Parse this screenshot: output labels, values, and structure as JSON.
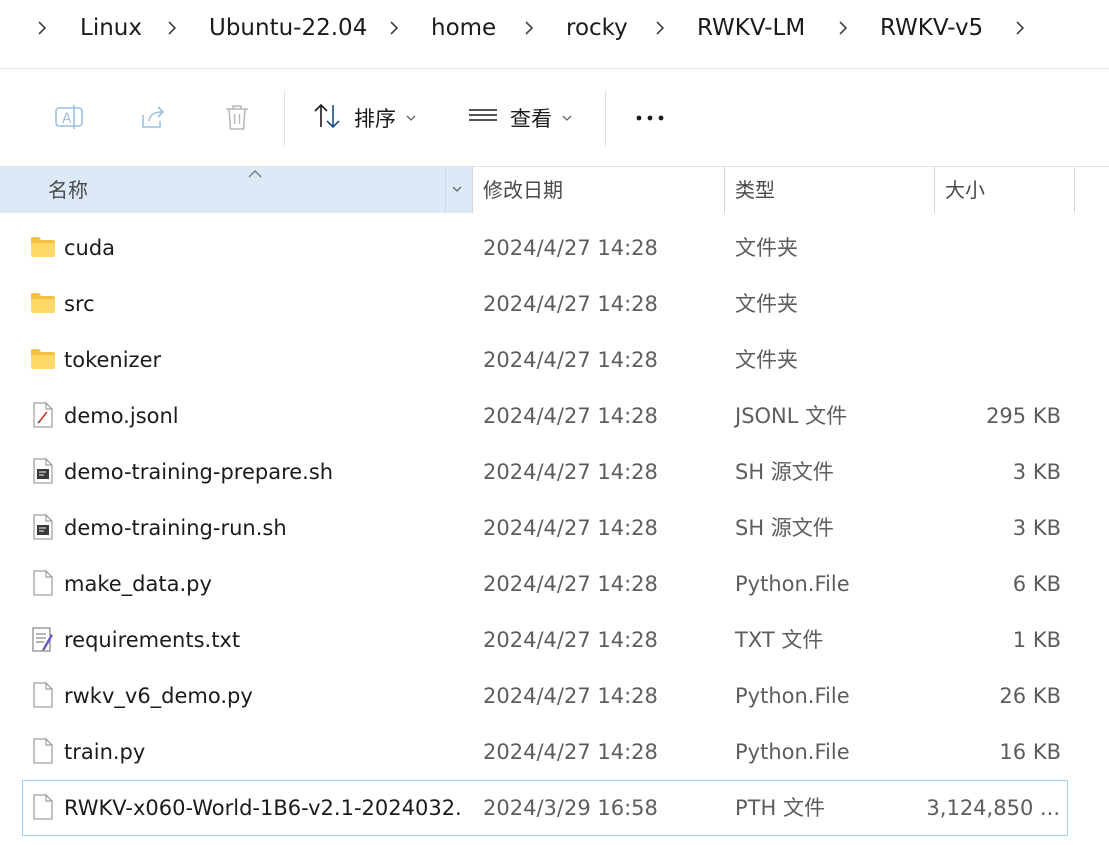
{
  "breadcrumb": [
    "Linux",
    "Ubuntu-22.04",
    "home",
    "rocky",
    "RWKV-LM",
    "RWKV-v5"
  ],
  "toolbar": {
    "sort_label": "排序",
    "view_label": "查看"
  },
  "columns": {
    "name": "名称",
    "date": "修改日期",
    "type": "类型",
    "size": "大小"
  },
  "files": [
    {
      "name": "cuda",
      "date": "2024/4/27 14:28",
      "type": "文件夹",
      "size": "",
      "icon": "folder-icon"
    },
    {
      "name": "src",
      "date": "2024/4/27 14:28",
      "type": "文件夹",
      "size": "",
      "icon": "folder-icon"
    },
    {
      "name": "tokenizer",
      "date": "2024/4/27 14:28",
      "type": "文件夹",
      "size": "",
      "icon": "folder-icon"
    },
    {
      "name": "demo.jsonl",
      "date": "2024/4/27 14:28",
      "type": "JSONL 文件",
      "size": "295 KB",
      "icon": "jsonl-file-icon"
    },
    {
      "name": "demo-training-prepare.sh",
      "date": "2024/4/27 14:28",
      "type": "SH 源文件",
      "size": "3 KB",
      "icon": "script-file-icon"
    },
    {
      "name": "demo-training-run.sh",
      "date": "2024/4/27 14:28",
      "type": "SH 源文件",
      "size": "3 KB",
      "icon": "script-file-icon"
    },
    {
      "name": "make_data.py",
      "date": "2024/4/27 14:28",
      "type": "Python.File",
      "size": "6 KB",
      "icon": "generic-file-icon"
    },
    {
      "name": "requirements.txt",
      "date": "2024/4/27 14:28",
      "type": "TXT 文件",
      "size": "1 KB",
      "icon": "text-file-icon"
    },
    {
      "name": "rwkv_v6_demo.py",
      "date": "2024/4/27 14:28",
      "type": "Python.File",
      "size": "26 KB",
      "icon": "generic-file-icon"
    },
    {
      "name": "train.py",
      "date": "2024/4/27 14:28",
      "type": "Python.File",
      "size": "16 KB",
      "icon": "generic-file-icon"
    },
    {
      "name": "RWKV-x060-World-1B6-v2.1-2024032...",
      "date": "2024/3/29 16:58",
      "type": "PTH 文件",
      "size": "3,124,850 ...",
      "icon": "generic-file-icon"
    }
  ]
}
